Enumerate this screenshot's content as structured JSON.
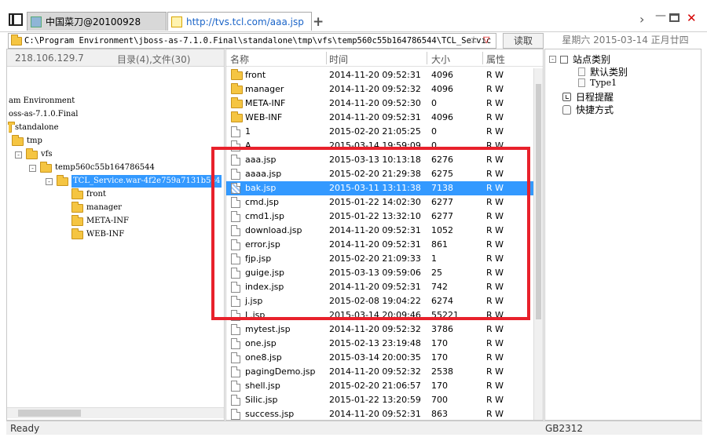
{
  "tabs": [
    {
      "label": "中国菜刀@20100928",
      "active": false
    },
    {
      "label": "http://tvs.tcl.com/aaa.jsp",
      "active": true
    }
  ],
  "address": {
    "path": "C:\\Program Environment\\jboss-as-7.1.0.Final\\standalone\\tmp\\vfs\\temp560c55b164786544\\TCL_Servic",
    "read_button": "读取",
    "date": "星期六 2015-03-14 正月廿四"
  },
  "left_pane": {
    "ip": "218.106.129.7",
    "dir_count": "目录(4),文件(30)",
    "tree": [
      {
        "label": "am Environment"
      },
      {
        "label": "oss-as-7.1.0.Final"
      },
      {
        "label": "standalone"
      },
      {
        "label": "tmp",
        "expander": "-"
      },
      {
        "label": "vfs",
        "expander": "-"
      },
      {
        "label": "temp560c55b164786544",
        "expander": "-"
      },
      {
        "label": "TCL_Service.war-4f2e759a7131b5c4",
        "expander": "-",
        "selected": true
      },
      {
        "label": "front"
      },
      {
        "label": "manager"
      },
      {
        "label": "META-INF"
      },
      {
        "label": "WEB-INF"
      }
    ]
  },
  "file_pane": {
    "columns": [
      "名称",
      "时间",
      "大小",
      "属性"
    ],
    "rows": [
      {
        "name": "front",
        "time": "2014-11-20 09:52:31",
        "size": "4096",
        "attr": "R W",
        "type": "folder"
      },
      {
        "name": "manager",
        "time": "2014-11-20 09:52:32",
        "size": "4096",
        "attr": "R W",
        "type": "folder"
      },
      {
        "name": "META-INF",
        "time": "2014-11-20 09:52:30",
        "size": "0",
        "attr": "R W",
        "type": "folder"
      },
      {
        "name": "WEB-INF",
        "time": "2014-11-20 09:52:31",
        "size": "4096",
        "attr": "R W",
        "type": "folder"
      },
      {
        "name": "1",
        "time": "2015-02-20 21:05:25",
        "size": "0",
        "attr": "R W",
        "type": "file"
      },
      {
        "name": "A",
        "time": "2015-03-14 19:59:09",
        "size": "0",
        "attr": "R W",
        "type": "file"
      },
      {
        "name": "aaa.jsp",
        "time": "2015-03-13 10:13:18",
        "size": "6276",
        "attr": "R W",
        "type": "file"
      },
      {
        "name": "aaaa.jsp",
        "time": "2015-02-20 21:29:38",
        "size": "6275",
        "attr": "R W",
        "type": "file"
      },
      {
        "name": "bak.jsp",
        "time": "2015-03-11 13:11:38",
        "size": "7138",
        "attr": "R W",
        "type": "file",
        "selected": true
      },
      {
        "name": "cmd.jsp",
        "time": "2015-01-22 14:02:30",
        "size": "6277",
        "attr": "R W",
        "type": "file"
      },
      {
        "name": "cmd1.jsp",
        "time": "2015-01-22 13:32:10",
        "size": "6277",
        "attr": "R W",
        "type": "file"
      },
      {
        "name": "download.jsp",
        "time": "2014-11-20 09:52:31",
        "size": "1052",
        "attr": "R W",
        "type": "file"
      },
      {
        "name": "error.jsp",
        "time": "2014-11-20 09:52:31",
        "size": "861",
        "attr": "R W",
        "type": "file"
      },
      {
        "name": "fjp.jsp",
        "time": "2015-02-20 21:09:33",
        "size": "1",
        "attr": "R W",
        "type": "file"
      },
      {
        "name": "guige.jsp",
        "time": "2015-03-13 09:59:06",
        "size": "25",
        "attr": "R W",
        "type": "file"
      },
      {
        "name": "index.jsp",
        "time": "2014-11-20 09:52:31",
        "size": "742",
        "attr": "R W",
        "type": "file"
      },
      {
        "name": "j.jsp",
        "time": "2015-02-08 19:04:22",
        "size": "6274",
        "attr": "R W",
        "type": "file"
      },
      {
        "name": "L.jsp",
        "time": "2015-03-14 20:09:46",
        "size": "55221",
        "attr": "R W",
        "type": "file"
      },
      {
        "name": "mytest.jsp",
        "time": "2014-11-20 09:52:32",
        "size": "3786",
        "attr": "R W",
        "type": "file"
      },
      {
        "name": "one.jsp",
        "time": "2015-02-13 23:19:48",
        "size": "170",
        "attr": "R W",
        "type": "file"
      },
      {
        "name": "one8.jsp",
        "time": "2015-03-14 20:00:35",
        "size": "170",
        "attr": "R W",
        "type": "file"
      },
      {
        "name": "pagingDemo.jsp",
        "time": "2014-11-20 09:52:32",
        "size": "2538",
        "attr": "R W",
        "type": "file"
      },
      {
        "name": "shell.jsp",
        "time": "2015-02-20 21:06:57",
        "size": "170",
        "attr": "R W",
        "type": "file"
      },
      {
        "name": "Silic.jsp",
        "time": "2015-01-22 13:20:59",
        "size": "700",
        "attr": "R W",
        "type": "file"
      },
      {
        "name": "success.jsp",
        "time": "2014-11-20 09:52:31",
        "size": "863",
        "attr": "R W",
        "type": "file"
      }
    ]
  },
  "right_pane": {
    "items": [
      {
        "label": "站点类别"
      },
      {
        "label": "默认类别"
      },
      {
        "label": "Type1"
      },
      {
        "label": "日程提醒"
      },
      {
        "label": "快捷方式"
      }
    ]
  },
  "status": {
    "text": "Ready",
    "encoding": "GB2312"
  },
  "colors": {
    "selection": "#3399ff",
    "highlight_box": "#e8212b",
    "link": "#1a64c8"
  }
}
